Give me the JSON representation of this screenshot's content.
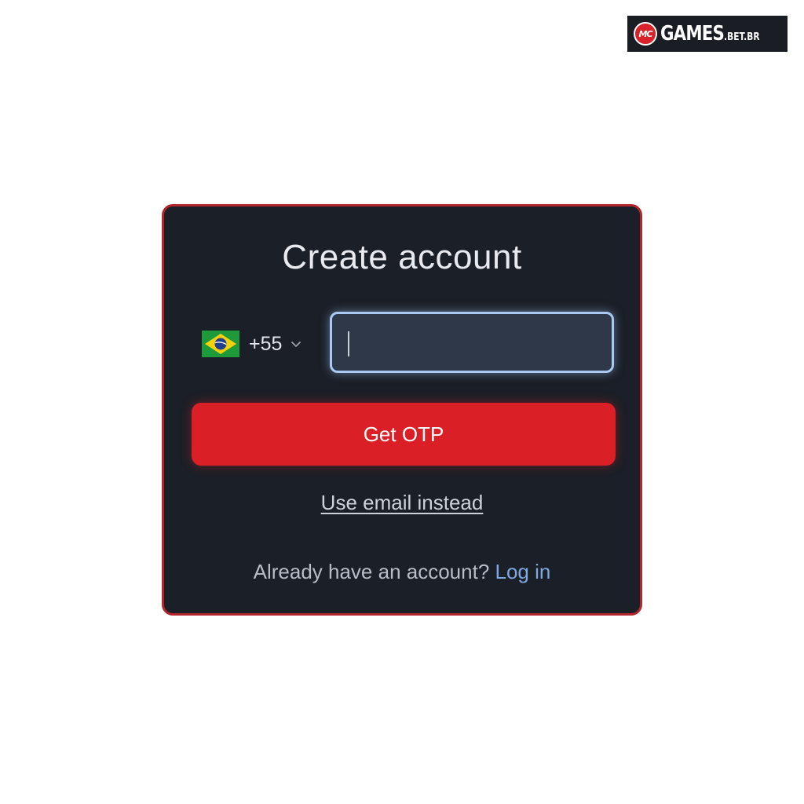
{
  "brand": {
    "logo_text": "GAMES",
    "logo_suffix": ".BET.BR",
    "badge_text": "MC"
  },
  "form": {
    "title": "Create account",
    "country": {
      "flag": "brazil-flag-icon",
      "dial_code": "+55",
      "dropdown_icon": "chevron-down-icon"
    },
    "phone_input": {
      "value": "",
      "placeholder": ""
    },
    "otp_button_label": "Get OTP",
    "alt_method_link": "Use email instead",
    "login_prompt": "Already have an account?",
    "login_link": "Log in"
  },
  "colors": {
    "card_bg": "#1b1f27",
    "card_border": "#b3262d",
    "primary_button": "#da1f26",
    "input_focus_border": "#a9c8f2",
    "link_accent": "#7fa9e3"
  }
}
